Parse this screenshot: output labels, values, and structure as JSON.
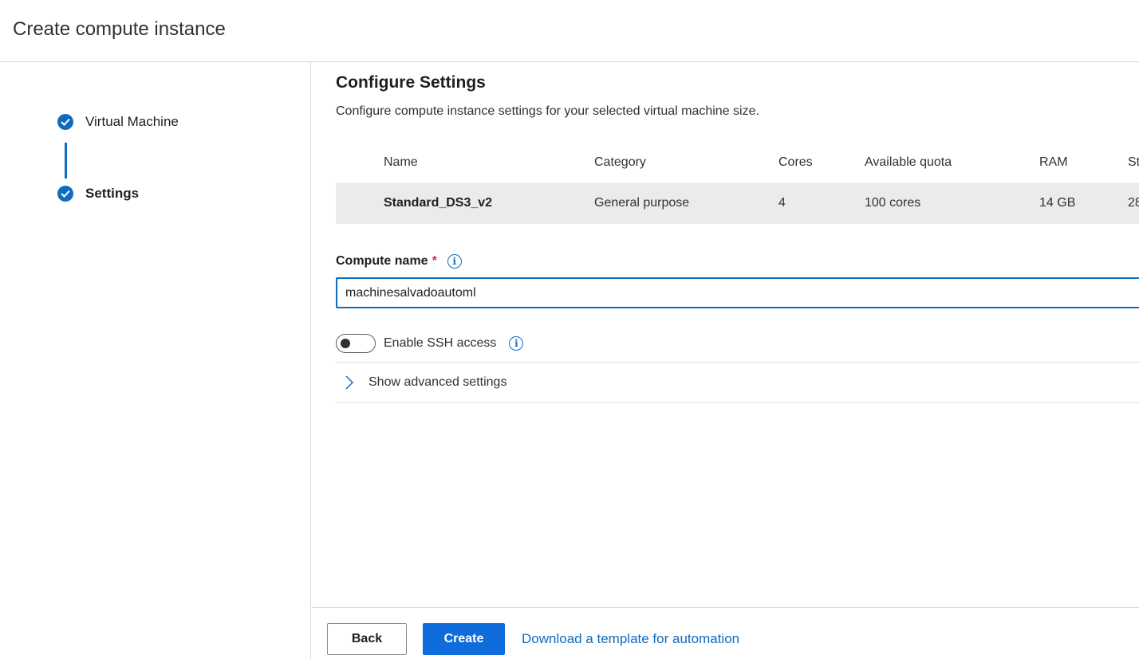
{
  "header": {
    "title": "Create compute instance"
  },
  "steps": [
    {
      "label": "Virtual Machine",
      "status": "complete"
    },
    {
      "label": "Settings",
      "status": "complete"
    }
  ],
  "main": {
    "title": "Configure Settings",
    "description": "Configure compute instance settings for your selected virtual machine size.",
    "table": {
      "columns": [
        "Name",
        "Category",
        "Cores",
        "Available quota",
        "RAM",
        "St"
      ],
      "row": [
        "Standard_DS3_v2",
        "General purpose",
        "4",
        "100 cores",
        "14 GB",
        "28"
      ]
    },
    "compute_name": {
      "label": "Compute name",
      "required_mark": "*",
      "value": "machinesalvadoautoml"
    },
    "ssh": {
      "label": "Enable SSH access",
      "enabled": false
    },
    "advanced": {
      "label": "Show advanced settings"
    }
  },
  "footer": {
    "back_label": "Back",
    "create_label": "Create",
    "template_link": "Download a template for automation"
  },
  "colors": {
    "accent": "#0f6cbd",
    "primary_button": "#0f6cdc",
    "required": "#c4314b"
  }
}
